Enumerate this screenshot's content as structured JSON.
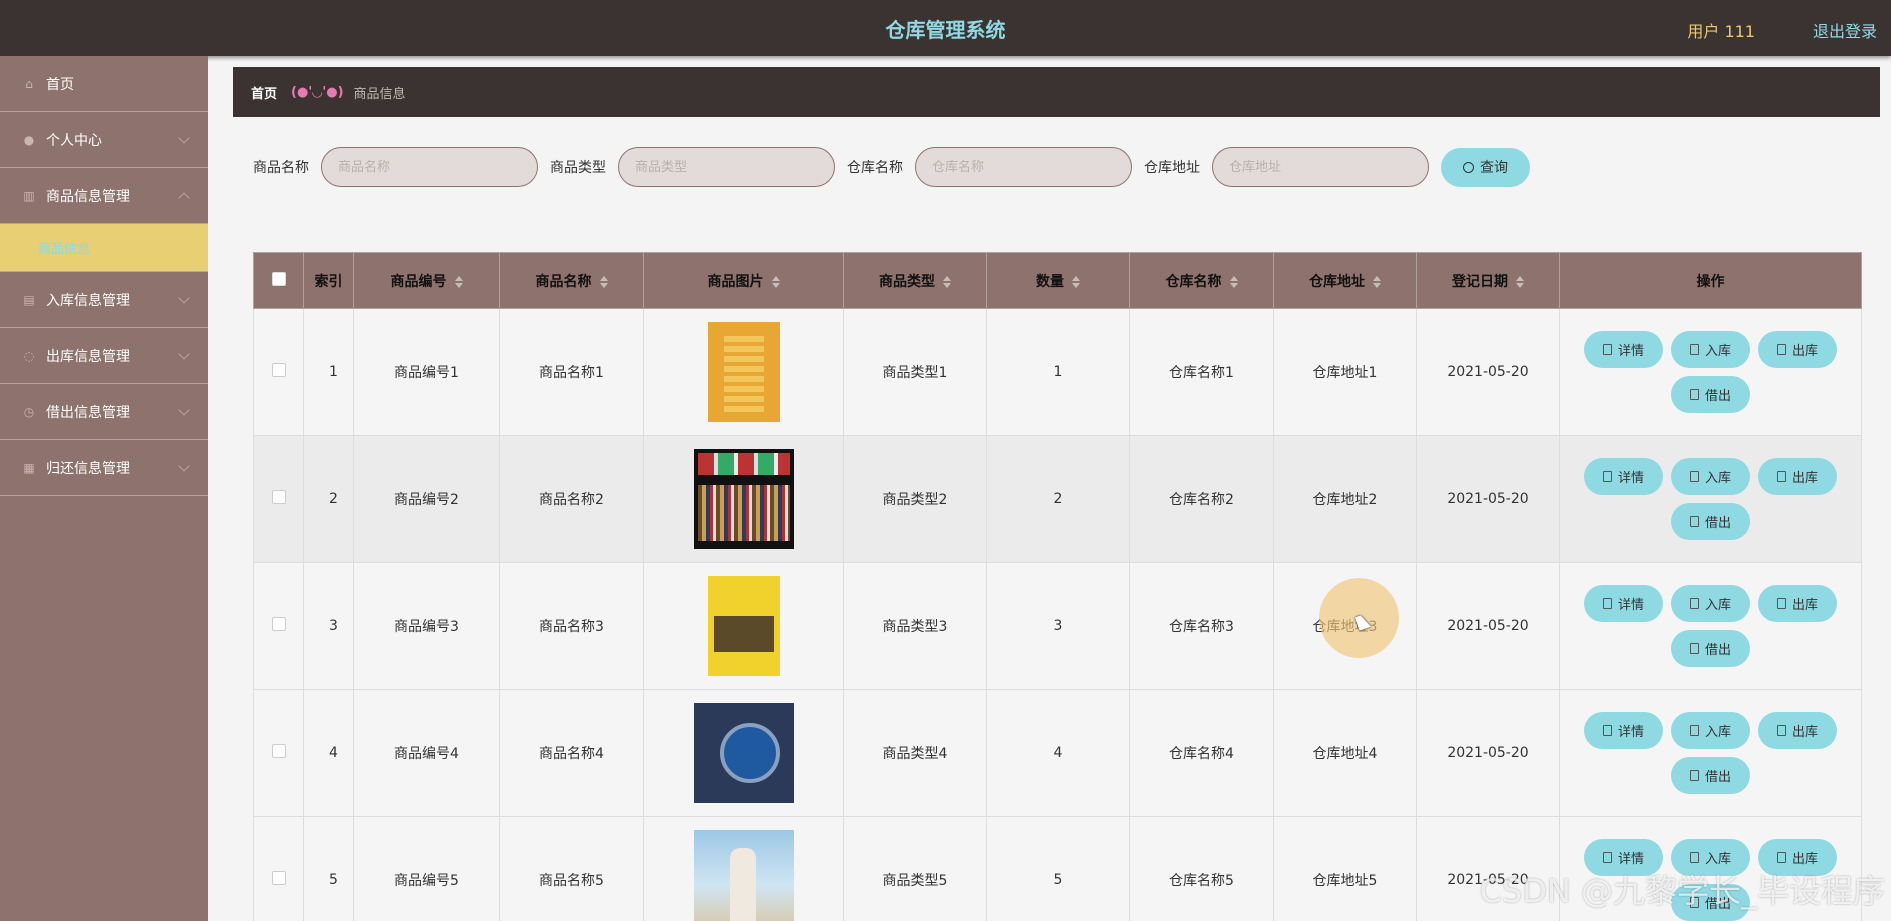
{
  "app": {
    "title": "仓库管理系统",
    "user_label": "用户 111",
    "logout_label": "退出登录"
  },
  "sidebar": {
    "items": [
      {
        "label": "首页",
        "icon": "home-icon"
      },
      {
        "label": "个人中心",
        "icon": "user-icon"
      },
      {
        "label": "商品信息管理",
        "icon": "chart-icon"
      },
      {
        "label": "入库信息管理",
        "icon": "list-icon"
      },
      {
        "label": "出库信息管理",
        "icon": "clock-icon"
      },
      {
        "label": "借出信息管理",
        "icon": "time-icon"
      },
      {
        "label": "归还信息管理",
        "icon": "grid-icon"
      }
    ],
    "active_sub": "商品信息"
  },
  "breadcrumb": {
    "home": "首页",
    "separator": "(●'◡'●)",
    "current": "商品信息"
  },
  "search": {
    "fields": [
      {
        "label": "商品名称",
        "placeholder": "商品名称"
      },
      {
        "label": "商品类型",
        "placeholder": "商品类型"
      },
      {
        "label": "仓库名称",
        "placeholder": "仓库名称"
      },
      {
        "label": "仓库地址",
        "placeholder": "仓库地址"
      }
    ],
    "button_label": "查询"
  },
  "table": {
    "headers": [
      "索引",
      "商品编号",
      "商品名称",
      "商品图片",
      "商品类型",
      "数量",
      "仓库名称",
      "仓库地址",
      "登记日期",
      "操作"
    ],
    "rows": [
      {
        "index": "1",
        "code": "商品编号1",
        "name": "商品名称1",
        "type": "商品类型1",
        "qty": "1",
        "wh_name": "仓库名称1",
        "wh_addr": "仓库地址1",
        "date": "2021-05-20"
      },
      {
        "index": "2",
        "code": "商品编号2",
        "name": "商品名称2",
        "type": "商品类型2",
        "qty": "2",
        "wh_name": "仓库名称2",
        "wh_addr": "仓库地址2",
        "date": "2021-05-20"
      },
      {
        "index": "3",
        "code": "商品编号3",
        "name": "商品名称3",
        "type": "商品类型3",
        "qty": "3",
        "wh_name": "仓库名称3",
        "wh_addr": "仓库地址3",
        "date": "2021-05-20"
      },
      {
        "index": "4",
        "code": "商品编号4",
        "name": "商品名称4",
        "type": "商品类型4",
        "qty": "4",
        "wh_name": "仓库名称4",
        "wh_addr": "仓库地址4",
        "date": "2021-05-20"
      },
      {
        "index": "5",
        "code": "商品编号5",
        "name": "商品名称5",
        "type": "商品类型5",
        "qty": "5",
        "wh_name": "仓库名称5",
        "wh_addr": "仓库地址5",
        "date": "2021-05-20"
      }
    ],
    "actions": {
      "detail": "详情",
      "inbound": "入库",
      "outbound": "出库",
      "lend": "借出"
    }
  },
  "watermark": "CSDN @九黎学长_毕设程序",
  "colors": {
    "header_bg": "#3b3331",
    "sidebar_bg": "#8e726d",
    "accent": "#8fd9e3",
    "active_submenu": "#e8cf73"
  }
}
